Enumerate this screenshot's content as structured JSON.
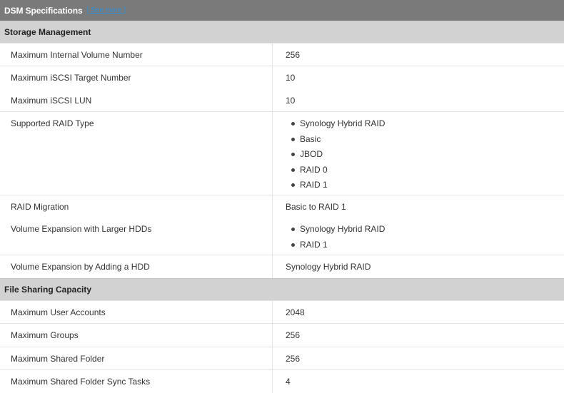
{
  "header": {
    "title": "DSM Specifications",
    "link": "[ See more ]"
  },
  "sections": {
    "storage": {
      "title": "Storage Management",
      "max_internal_volume": {
        "label": "Maximum Internal Volume Number",
        "value": "256"
      },
      "max_iscsi_target": {
        "label": "Maximum iSCSI Target Number",
        "value": "10"
      },
      "max_iscsi_lun": {
        "label": "Maximum iSCSI LUN",
        "value": "10"
      },
      "raid_type": {
        "label": "Supported RAID Type",
        "options": [
          "Synology Hybrid RAID",
          "Basic",
          "JBOD",
          "RAID 0",
          "RAID 1"
        ]
      },
      "raid_migration": {
        "label": "RAID Migration",
        "value": "Basic to RAID 1"
      },
      "expansion_larger": {
        "label": "Volume Expansion with Larger HDDs",
        "options": [
          "Synology Hybrid RAID",
          "RAID 1"
        ]
      },
      "expansion_adding": {
        "label": "Volume Expansion by Adding a HDD",
        "value": "Synology Hybrid RAID"
      }
    },
    "file_sharing": {
      "title": "File Sharing Capacity",
      "max_user_accounts": {
        "label": "Maximum User Accounts",
        "value": "2048"
      },
      "max_groups": {
        "label": "Maximum Groups",
        "value": "256"
      },
      "max_shared_folder": {
        "label": "Maximum Shared Folder",
        "value": "256"
      },
      "max_sync_tasks": {
        "label": "Maximum Shared Folder Sync Tasks",
        "value": "4"
      }
    }
  },
  "icons": {
    "bullet": "bullet-dot-icon"
  },
  "colors": {
    "title_bar": "#7a7a7a",
    "section_bg": "#d2d2d2",
    "link": "#2b8fd6"
  }
}
